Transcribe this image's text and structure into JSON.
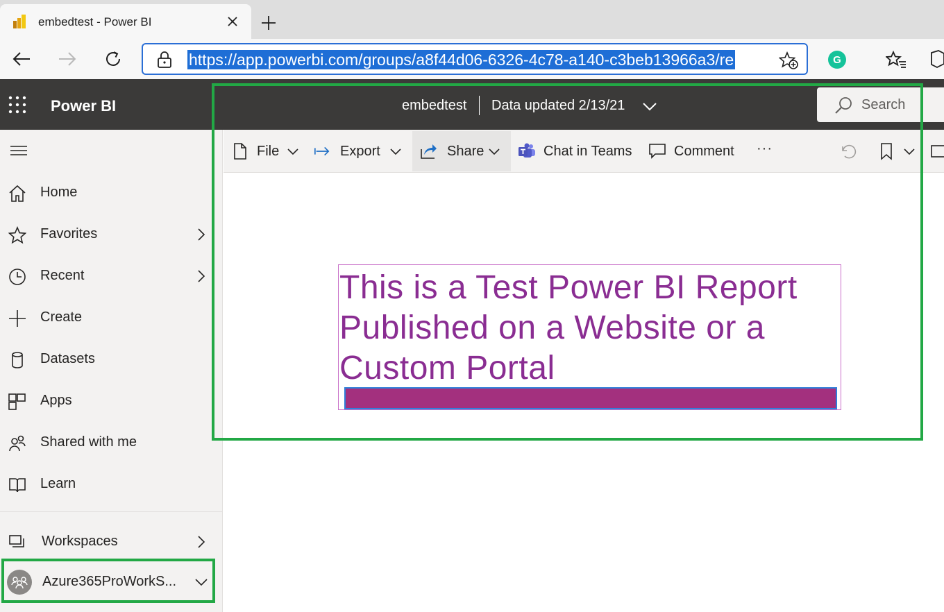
{
  "browser": {
    "tab": {
      "title": "embedtest - Power BI"
    },
    "address_bar": {
      "url": "https://app.powerbi.com/groups/a8f44d06-6326-4c78-a140-c3beb13966a3/re"
    },
    "extension_grammarly": "G"
  },
  "header": {
    "brand": "Power BI",
    "report_name": "embedtest",
    "separator": "|",
    "data_updated": "Data updated 2/13/21",
    "search_label": "Search"
  },
  "sidebar": {
    "items": [
      {
        "label": "Home",
        "icon": "home-icon"
      },
      {
        "label": "Favorites",
        "icon": "star-icon"
      },
      {
        "label": "Recent",
        "icon": "clock-icon"
      },
      {
        "label": "Create",
        "icon": "plus-icon"
      },
      {
        "label": "Datasets",
        "icon": "database-icon"
      },
      {
        "label": "Apps",
        "icon": "apps-icon"
      },
      {
        "label": "Shared with me",
        "icon": "shared-icon"
      },
      {
        "label": "Learn",
        "icon": "book-icon"
      }
    ],
    "workspaces_label": "Workspaces",
    "current_workspace": "Azure365ProWorkS..."
  },
  "commandbar": {
    "file": "File",
    "export": "Export",
    "share": "Share",
    "chat": "Chat in Teams",
    "comment": "Comment",
    "more": "···"
  },
  "report": {
    "text_line1": "This is a Test Power BI Report",
    "text_line2": "Published on a Website or a",
    "text_line3": "Custom Portal"
  },
  "colors": {
    "header_bg": "#3b3a39",
    "report_text": "#8a2d92",
    "report_bar": "#a3307e",
    "highlight": "#22a845",
    "url_selection": "#1e6ed6"
  }
}
